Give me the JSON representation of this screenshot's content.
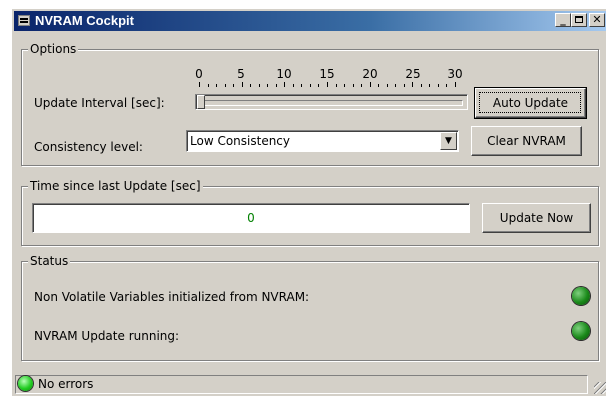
{
  "window": {
    "title": "NVRAM Cockpit"
  },
  "options": {
    "legend": "Options",
    "interval_label": "Update Interval [sec]:",
    "interval_value": 0,
    "interval_range": [
      0,
      30
    ],
    "tick_labels": [
      "0",
      "5",
      "10",
      "15",
      "20",
      "25",
      "30"
    ],
    "consistency_label": "Consistency level:",
    "consistency_value": "Low Consistency",
    "auto_update_label": "Auto Update",
    "clear_label": "Clear NVRAM"
  },
  "time_group": {
    "legend": "Time since last Update [sec]",
    "value": "0",
    "update_now_label": "Update Now",
    "value_color": "#008000"
  },
  "status": {
    "legend": "Status",
    "items": [
      {
        "label": "Non Volatile Variables initialized from NVRAM:",
        "led_color": "#1a8a1a"
      },
      {
        "label": "NVRAM Update running:",
        "led_color": "#1a8a1a"
      }
    ]
  },
  "statusbar": {
    "text": "No errors",
    "led_color": "#22cc22"
  },
  "icons": [
    "app-icon",
    "minimize-icon",
    "maximize-icon",
    "close-icon",
    "chevron-down-icon",
    "size-grip-icon"
  ]
}
